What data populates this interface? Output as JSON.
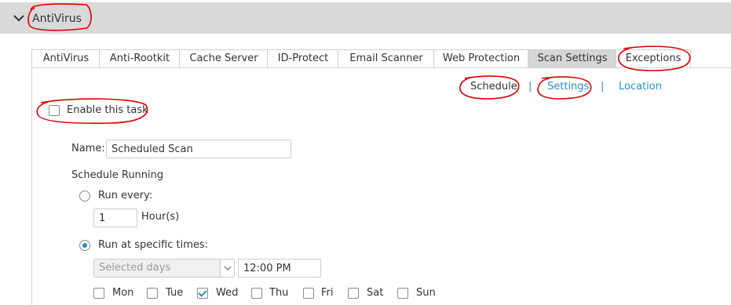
{
  "header": {
    "title": "AntiVirus",
    "toggle_icon": "chevron-down-icon"
  },
  "tabs": [
    {
      "label": "AntiVirus"
    },
    {
      "label": "Anti-Rootkit"
    },
    {
      "label": "Cache Server"
    },
    {
      "label": "ID-Protect"
    },
    {
      "label": "Email Scanner"
    },
    {
      "label": "Web Protection"
    },
    {
      "label": "Scan Settings",
      "active": true
    },
    {
      "label": "Exceptions"
    }
  ],
  "subnav": {
    "schedule": "Schedule",
    "separator": "|",
    "settings": "Settings",
    "location": "Location"
  },
  "task": {
    "enable_label": "Enable this task",
    "enabled": false,
    "name_label": "Name:",
    "name_value": "Scheduled Scan",
    "schedule_heading": "Schedule Running",
    "run_every_label": "Run every:",
    "interval_value": "1",
    "interval_unit": "Hour(s)",
    "run_specific_label": "Run at specific times:",
    "days_select_value": "Selected days",
    "time_value": "12:00 PM",
    "days": [
      {
        "label": "Mon",
        "checked": false
      },
      {
        "label": "Tue",
        "checked": false
      },
      {
        "label": "Wed",
        "checked": true
      },
      {
        "label": "Thu",
        "checked": false
      },
      {
        "label": "Fri",
        "checked": false
      },
      {
        "label": "Sat",
        "checked": false
      },
      {
        "label": "Sun",
        "checked": false
      }
    ]
  },
  "colors": {
    "link": "#2a8ec9",
    "annotation": "#e00000",
    "header_bg": "#d9d9d9",
    "active_tab": "#d6d6d6"
  }
}
